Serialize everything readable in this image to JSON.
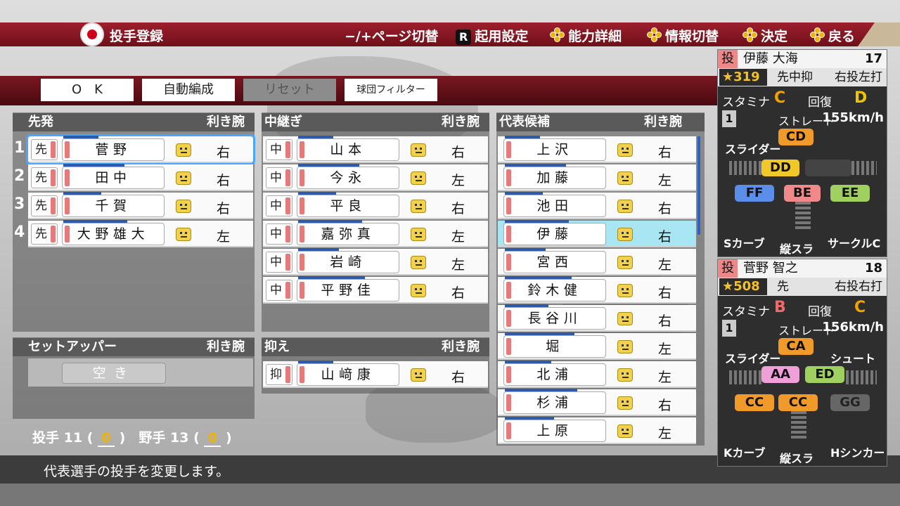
{
  "header": {
    "title": "投手登録",
    "hints": [
      {
        "key": "−/+",
        "label": "ページ切替"
      },
      {
        "key": "R",
        "label": "起用設定"
      },
      {
        "key": "dpad",
        "label": "能力詳細"
      },
      {
        "key": "dpad",
        "label": "情報切替"
      },
      {
        "key": "dpad",
        "label": "決定"
      },
      {
        "key": "dpad",
        "label": "戻る"
      }
    ]
  },
  "toolbar": {
    "ok": "O　K",
    "auto": "自動編成",
    "reset": "リセット",
    "filter": "球団フィルター"
  },
  "starters": {
    "title": "先発",
    "hand_col": "利き腕",
    "rows": [
      {
        "n": "1",
        "role": "先",
        "name": "菅野",
        "hand": "右"
      },
      {
        "n": "2",
        "role": "先",
        "name": "田中",
        "hand": "右"
      },
      {
        "n": "3",
        "role": "先",
        "name": "千賀",
        "hand": "右"
      },
      {
        "n": "4",
        "role": "先",
        "name": "大野雄大",
        "hand": "左"
      }
    ]
  },
  "setup": {
    "title": "セットアッパー",
    "hand_col": "利き腕",
    "empty": "空き"
  },
  "relief": {
    "title": "中継ぎ",
    "hand_col": "利き腕",
    "rows": [
      {
        "role": "中",
        "name": "山本",
        "hand": "右"
      },
      {
        "role": "中",
        "name": "今永",
        "hand": "左"
      },
      {
        "role": "中",
        "name": "平良",
        "hand": "右"
      },
      {
        "role": "中",
        "name": "嘉弥真",
        "hand": "左"
      },
      {
        "role": "中",
        "name": "岩崎",
        "hand": "左"
      },
      {
        "role": "中",
        "name": "平野佳",
        "hand": "右"
      }
    ]
  },
  "closer": {
    "title": "抑え",
    "hand_col": "利き腕",
    "rows": [
      {
        "role": "抑",
        "name": "山﨑康",
        "hand": "右"
      }
    ]
  },
  "candidates": {
    "title": "代表候補",
    "hand_col": "利き腕",
    "rows": [
      {
        "name": "上沢",
        "hand": "右"
      },
      {
        "name": "加藤",
        "hand": "左"
      },
      {
        "name": "池田",
        "hand": "右"
      },
      {
        "name": "伊藤",
        "hand": "右"
      },
      {
        "name": "宮西",
        "hand": "左"
      },
      {
        "name": "鈴木健",
        "hand": "右"
      },
      {
        "name": "長谷川",
        "hand": "右"
      },
      {
        "name": "堀",
        "hand": "左"
      },
      {
        "name": "北浦",
        "hand": "左"
      },
      {
        "name": "杉浦",
        "hand": "右"
      },
      {
        "name": "上原",
        "hand": "左"
      }
    ]
  },
  "counts": {
    "p_label": "投手",
    "p": "11",
    "p_sub": "0",
    "f_label": "野手",
    "f": "13",
    "f_sub": "0",
    "lp": "(",
    "rp": ")"
  },
  "status": "代表選手の投手を変更します。",
  "card1": {
    "tag": "投",
    "name": "伊藤 大海",
    "no": "17",
    "ovr": "★319",
    "pos": "先中抑",
    "hand": "右投左打",
    "stamina_label": "スタミナ",
    "stamina": "C",
    "rec_label": "回復",
    "rec": "D",
    "one": "1",
    "fast_label": "ストレート",
    "speed": "155km/h",
    "pitches": {
      "top_label": "スライダー",
      "top": "CD",
      "left_grade": "DD",
      "p1": "FF",
      "p2": "BE",
      "p3": "EE",
      "l1": "Sカーブ",
      "l2": "縦スラ",
      "l3": "サークルC"
    }
  },
  "card2": {
    "tag": "投",
    "name": "菅野 智之",
    "no": "18",
    "ovr": "★508",
    "pos": "先",
    "hand": "右投右打",
    "stamina_label": "スタミナ",
    "stamina": "B",
    "rec_label": "回復",
    "rec": "C",
    "one": "1",
    "fast_label": "ストレート",
    "speed": "156km/h",
    "pitches": {
      "top_label": "スライダー",
      "top": "CA",
      "right_label": "シュート",
      "left_grade": "AA",
      "right_grade": "ED",
      "p1": "CC",
      "p2": "CC",
      "p3": "GG",
      "l1": "Kカーブ",
      "l2": "縦スラ",
      "l3": "Hシンカー"
    }
  },
  "colors": {
    "accent": "#9e1f2d",
    "gold": "#f0b400",
    "select": "#48a6ff",
    "highlight": "#a8e6f4"
  }
}
